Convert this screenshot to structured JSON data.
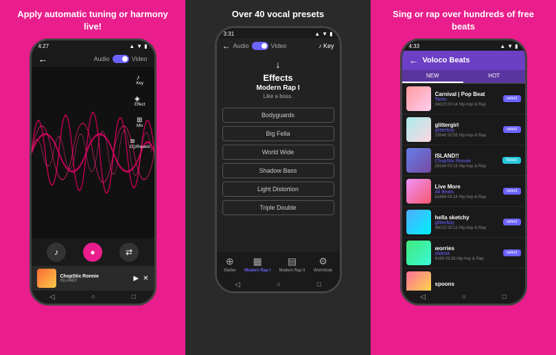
{
  "panel_left": {
    "caption": "Apply automatic tuning\nor harmony live!",
    "status_time": "4:27",
    "header": {
      "audio_label": "Audio",
      "video_label": "Video"
    },
    "controls": {
      "key_label": "Key",
      "effect_label": "Effect",
      "mix_label": "Mix",
      "eq_label": "EQ/Reverb"
    },
    "now_playing": {
      "title": "ChopStix Ronnie",
      "artist": "ISLAND!!"
    },
    "nav": [
      "back",
      "home",
      "recents"
    ]
  },
  "panel_middle": {
    "caption": "Over 40 vocal presets",
    "status_time": "3:31",
    "header": {
      "audio_label": "Audio",
      "video_label": "Video"
    },
    "effects_title": "Effects",
    "preset_name": "Modern Rap I",
    "preset_desc": "Like a boss.",
    "effects_list": [
      "Bodyguards",
      "Big Fella",
      "World Wide",
      "Shadow Bass",
      "Light Distortion",
      "Triple Double"
    ],
    "presets_bar": {
      "starter_label": "Starter",
      "modern_rap1_label": "Modern Rap I",
      "modern_rap2_label": "Modern Rap II",
      "wormhole_label": "Wormhole"
    }
  },
  "panel_right": {
    "caption": "Sing or rap\nover hundreds of free beats",
    "status_time": "4:33",
    "title": "Voloco Beats",
    "tabs": [
      "NEW",
      "HOT"
    ],
    "beats": [
      {
        "name": "Carnival | Pop Beat",
        "artist": "Tantu",
        "plays": "34223",
        "duration": "03:14",
        "genre": "Hip-hop & Rap",
        "select": "select"
      },
      {
        "name": "glittergirl",
        "artist": "glitterboy",
        "plays": "13546",
        "duration": "02:55",
        "genre": "Hip-hop & Rap",
        "select": "select"
      },
      {
        "name": "ISLAND!!",
        "artist": "ChopStix Ronnie",
        "plays": "28164",
        "duration": "03:15",
        "genre": "Hip-hop & Rap",
        "select": "Select"
      },
      {
        "name": "Live More",
        "artist": "All Beats",
        "plays": "62466",
        "duration": "03:14",
        "genre": "Hip-hop & Rap",
        "select": "select"
      },
      {
        "name": "hella sketchy",
        "artist": "glitterboy",
        "plays": "46015",
        "duration": "05:12",
        "genre": "Hip-hop & Rap",
        "select": "select"
      },
      {
        "name": "worries",
        "artist": "slidexit",
        "plays": "4169",
        "duration": "03:28",
        "genre": "Hip-hop & Rap",
        "select": "select"
      },
      {
        "name": "spoons",
        "artist": "",
        "plays": "",
        "duration": "",
        "genre": "",
        "select": ""
      }
    ]
  }
}
